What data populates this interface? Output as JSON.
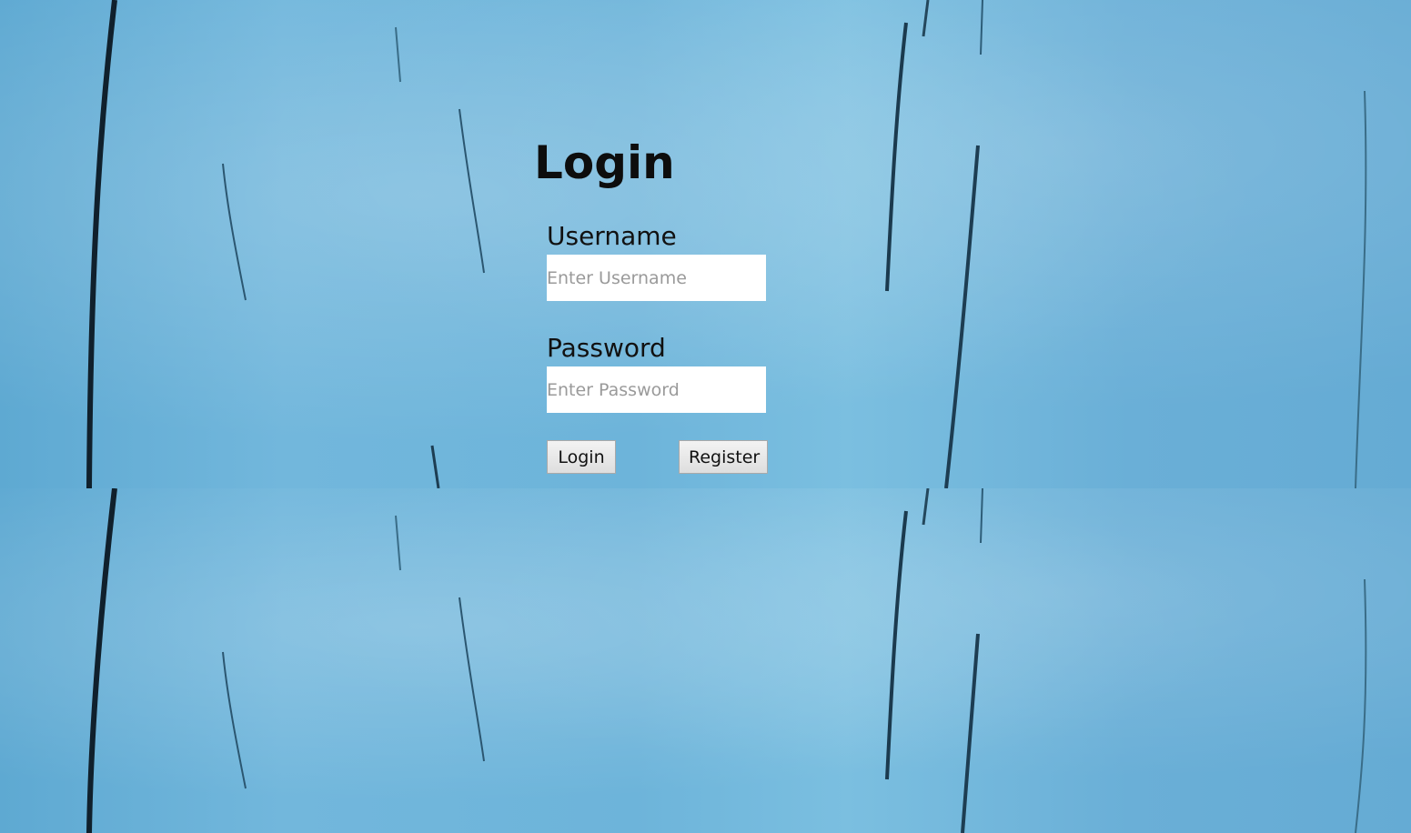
{
  "form": {
    "title": "Login",
    "username": {
      "label": "Username",
      "placeholder": "Enter Username",
      "value": ""
    },
    "password": {
      "label": "Password",
      "placeholder": "Enter Password",
      "value": ""
    },
    "login_button": "Login",
    "register_button": "Register"
  },
  "theme": {
    "background_color": "#6fb3d8",
    "text_color": "#0d0d0d",
    "input_background": "#ffffff"
  }
}
